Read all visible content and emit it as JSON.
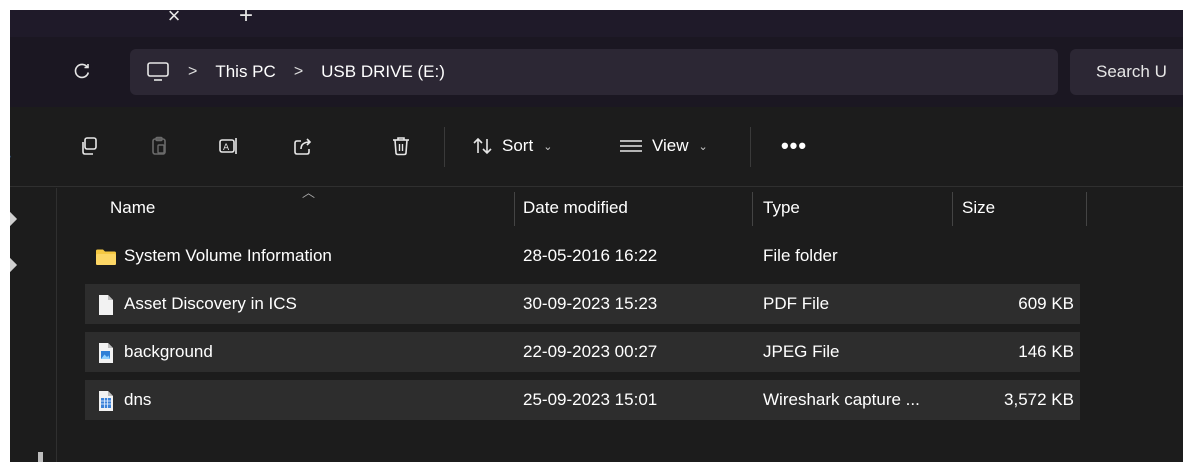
{
  "tabstrip": {
    "close_glyph": "×",
    "new_glyph": "+"
  },
  "navbar": {
    "breadcrumb": [
      "This PC",
      "USB DRIVE (E:)"
    ],
    "separator": ">",
    "search_placeholder": "Search U"
  },
  "commandbar": {
    "sort_label": "Sort",
    "view_label": "View",
    "more_label": "•••",
    "dropdown_glyph": "⌄"
  },
  "columns": {
    "name": "Name",
    "date": "Date modified",
    "type": "Type",
    "size": "Size"
  },
  "files": [
    {
      "name": "System Volume Information",
      "date": "28-05-2016 16:22",
      "type": "File folder",
      "size": "",
      "icon": "folder-icon"
    },
    {
      "name": "Asset Discovery in ICS",
      "date": "30-09-2023 15:23",
      "type": "PDF File",
      "size": "609 KB",
      "icon": "pdf-file-icon"
    },
    {
      "name": "background",
      "date": "22-09-2023 00:27",
      "type": "JPEG File",
      "size": "146 KB",
      "icon": "image-file-icon"
    },
    {
      "name": "dns",
      "date": "25-09-2023 15:01",
      "type": "Wireshark capture ...",
      "size": "3,572 KB",
      "icon": "capture-file-icon"
    }
  ],
  "colors": {
    "background": "#1c1c1c",
    "row_highlight": "#2d2d2d",
    "address_bg": "#2c2734",
    "accent_blue": "#4a9cff",
    "folder": "#f5c842"
  }
}
